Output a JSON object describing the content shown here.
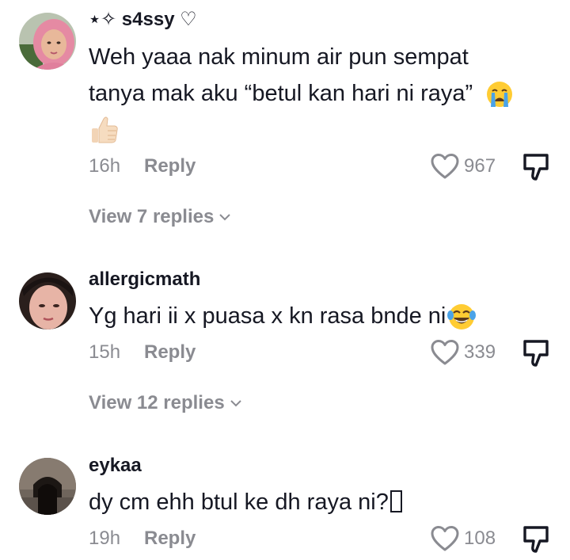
{
  "comments": [
    {
      "username": "⋆✧ s4ssy ♡",
      "text_line1": "Weh yaaa nak minum air pun sempat",
      "text_line2": "tanya mak aku “betul kan hari ni raya”",
      "emoji_after_line2": "loudly-crying-face",
      "emoji_line3": "thumbs-up",
      "time": "16h",
      "reply_label": "Reply",
      "likes": "967",
      "view_replies": "View 7 replies"
    },
    {
      "username": "allergicmath",
      "text": "Yg hari ii x puasa x kn rasa bnde ni",
      "emoji_after_text": "face-with-tears-of-joy",
      "time": "15h",
      "reply_label": "Reply",
      "likes": "339",
      "view_replies": "View 12 replies"
    },
    {
      "username": "eykaa",
      "text": "dy cm ehh btul ke dh raya ni?",
      "trailing_glyph": "missing-glyph-box",
      "time": "19h",
      "reply_label": "Reply",
      "likes": "108"
    }
  ],
  "colors": {
    "primary_text": "#161823",
    "secondary_text": "#8a8b91",
    "background": "#ffffff"
  }
}
